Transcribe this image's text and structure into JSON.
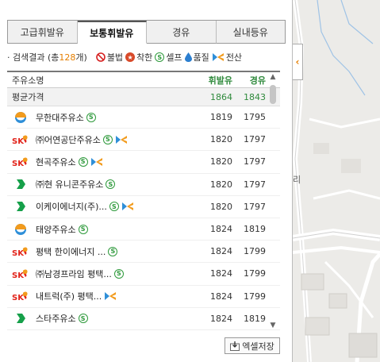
{
  "tabs": [
    {
      "label": "고급휘발유",
      "active": false
    },
    {
      "label": "보통휘발유",
      "active": true
    },
    {
      "label": "경유",
      "active": false
    },
    {
      "label": "실내등유",
      "active": false
    }
  ],
  "summary": {
    "prefix": "· 검색결과 (총 ",
    "count": "128",
    "suffix": "개)",
    "legend": [
      {
        "icon": "no-entry-icon",
        "label": "불법"
      },
      {
        "icon": "good-price-icon",
        "label": "착한"
      },
      {
        "icon": "self-service-icon",
        "label": "셀프"
      },
      {
        "icon": "quality-drop-icon",
        "label": "품질"
      },
      {
        "icon": "oilbank-card-icon",
        "label": "전산"
      }
    ]
  },
  "table": {
    "headers": {
      "name": "주유소명",
      "p1": "휘발유",
      "p2": "경유"
    },
    "average": {
      "label": "평균가격",
      "p1": "1864",
      "p2": "1843"
    },
    "rows": [
      {
        "brand": "hyundai-oilbank",
        "name": "무한대주유소",
        "self": true,
        "oil": false,
        "p1": "1819",
        "p2": "1795"
      },
      {
        "brand": "sk",
        "name": "㈜어연공단주유소",
        "self": true,
        "oil": true,
        "p1": "1820",
        "p2": "1797"
      },
      {
        "brand": "sk",
        "name": "현곡주유소",
        "self": true,
        "oil": true,
        "p1": "1820",
        "p2": "1797"
      },
      {
        "brand": "gs",
        "name": "㈜현 유니콘주유소",
        "self": true,
        "oil": false,
        "p1": "1820",
        "p2": "1797"
      },
      {
        "brand": "gs",
        "name": "이케이에너지(주)...",
        "self": true,
        "oil": true,
        "p1": "1820",
        "p2": "1797"
      },
      {
        "brand": "hyundai-oilbank",
        "name": "태양주유소",
        "self": true,
        "oil": false,
        "p1": "1824",
        "p2": "1819"
      },
      {
        "brand": "sk",
        "name": "평택 한이에너지 ...",
        "self": true,
        "oil": false,
        "p1": "1824",
        "p2": "1799"
      },
      {
        "brand": "sk",
        "name": "㈜남경프라임 평택...",
        "self": true,
        "oil": false,
        "p1": "1824",
        "p2": "1799"
      },
      {
        "brand": "sk",
        "name": "내트럭(주) 평택...",
        "self": false,
        "oil": true,
        "p1": "1824",
        "p2": "1799"
      },
      {
        "brand": "gs",
        "name": "스타주유소",
        "self": true,
        "oil": false,
        "p1": "1824",
        "p2": "1819"
      }
    ]
  },
  "excel_button": "엑셀저장",
  "map": {
    "label": "리"
  },
  "colors": {
    "accent": "#e67e00",
    "price_green": "#2f8a3c",
    "sk_red": "#e2231a",
    "gs_green": "#16a04a"
  }
}
